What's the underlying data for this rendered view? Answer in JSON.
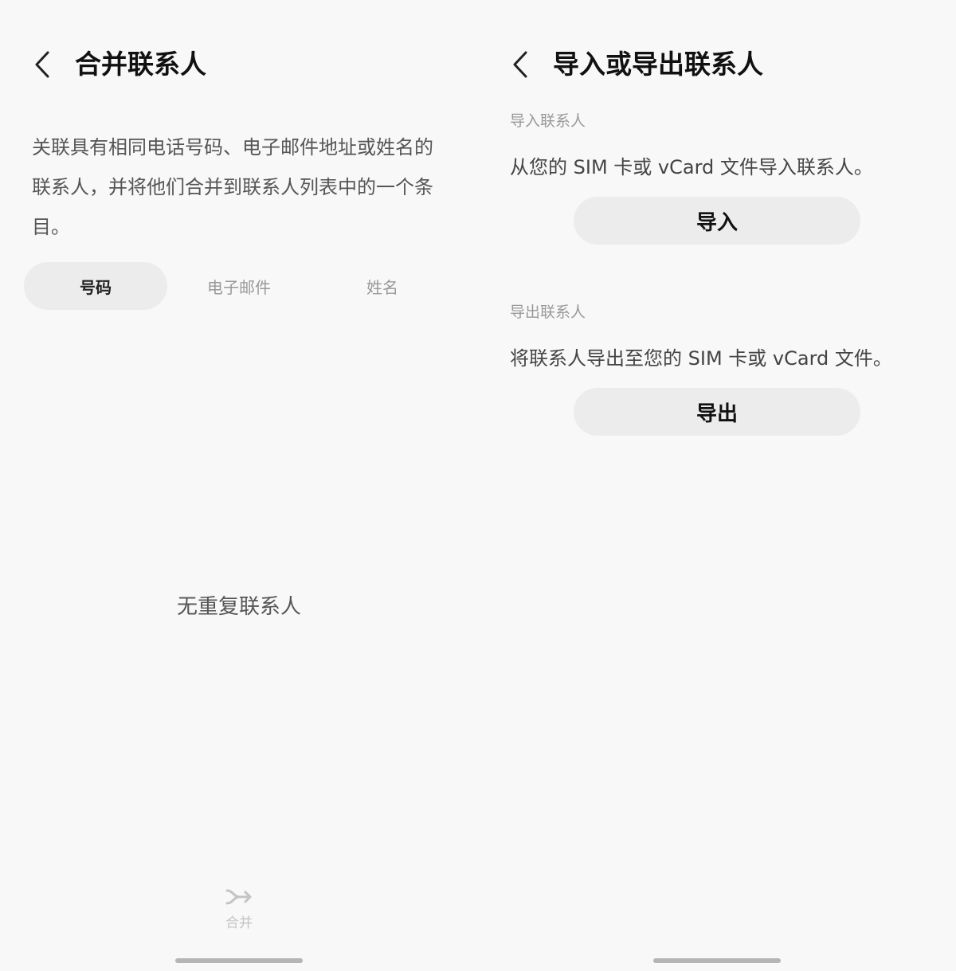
{
  "merge_screen": {
    "title": "合并联系人",
    "description": "关联具有相同电话号码、电子邮件地址或姓名的联系人，并将他们合并到联系人列表中的一个条目。",
    "tabs": [
      {
        "label": "号码",
        "active": true
      },
      {
        "label": "电子邮件",
        "active": false
      },
      {
        "label": "姓名",
        "active": false
      }
    ],
    "empty_text": "无重复联系人",
    "merge_action_label": "合并"
  },
  "import_export_screen": {
    "title": "导入或导出联系人",
    "import_section": {
      "label": "导入联系人",
      "text": "从您的 SIM 卡或 vCard 文件导入联系人。",
      "button_label": "导入"
    },
    "export_section": {
      "label": "导出联系人",
      "text": "将联系人导出至您的 SIM 卡或 vCard 文件。",
      "button_label": "导出"
    }
  },
  "icons": {
    "back": "chevron-left-icon",
    "merge": "merge-arrow-icon"
  },
  "colors": {
    "background": "#f8f8f8",
    "active_tab": "#ececec",
    "button": "#ececec",
    "title": "#111111"
  }
}
